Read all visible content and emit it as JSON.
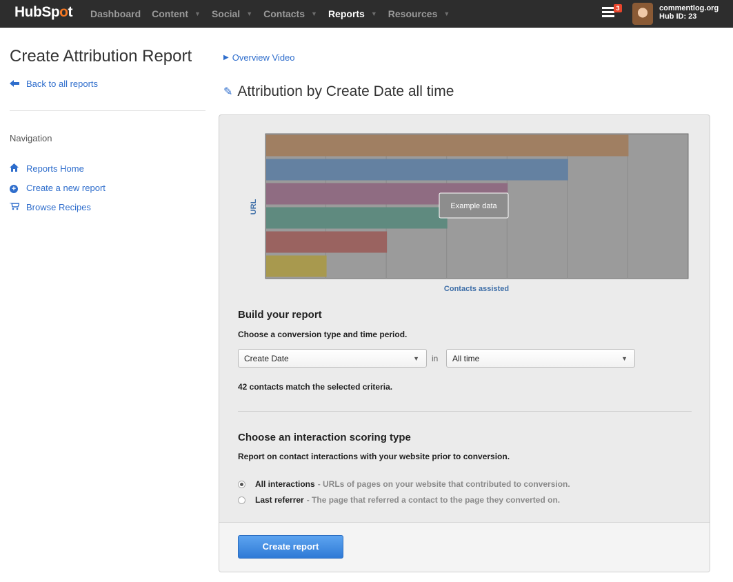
{
  "topbar": {
    "logo_prefix": "HubSp",
    "logo_o": "o",
    "logo_suffix": "t",
    "nav": [
      {
        "label": "Dashboard",
        "caret": false,
        "active": false
      },
      {
        "label": "Content",
        "caret": true,
        "active": false
      },
      {
        "label": "Social",
        "caret": true,
        "active": false
      },
      {
        "label": "Contacts",
        "caret": true,
        "active": false
      },
      {
        "label": "Reports",
        "caret": true,
        "active": true
      },
      {
        "label": "Resources",
        "caret": true,
        "active": false
      }
    ],
    "notification_count": "3",
    "account_name": "commentlog.org",
    "hub_id": "Hub ID: 23"
  },
  "sidebar": {
    "title": "Create Attribution Report",
    "back_link": "Back to all reports",
    "nav_heading": "Navigation",
    "items": [
      {
        "label": "Reports Home",
        "icon": "home-icon"
      },
      {
        "label": "Create a new report",
        "icon": "plus-circle-icon"
      },
      {
        "label": "Browse Recipes",
        "icon": "cart-icon"
      }
    ]
  },
  "main": {
    "overview_link": "Overview Video",
    "report_title": "Attribution by Create Date all time"
  },
  "chart_data": {
    "type": "bar",
    "orientation": "horizontal",
    "ylabel": "URL",
    "xlabel": "Contacts assisted",
    "overlay_label": "Example data",
    "grid": true,
    "xlim": [
      0,
      7
    ],
    "values": [
      6,
      5,
      4,
      3,
      2,
      1
    ],
    "colors": [
      "#a07f62",
      "#6481a1",
      "#8f6c82",
      "#5f8a7f",
      "#9a6360",
      "#a8994e"
    ]
  },
  "build": {
    "heading": "Build your report",
    "subheading": "Choose a conversion type and time period.",
    "conversion_type": "Create Date",
    "in_word": "in",
    "time_period": "All time",
    "match_text": "42 contacts match the selected criteria."
  },
  "scoring": {
    "heading": "Choose an interaction scoring type",
    "subheading": "Report on contact interactions with your website prior to conversion.",
    "options": [
      {
        "label": "All interactions",
        "desc": "- URLs of pages on your website that contributed to conversion.",
        "selected": true
      },
      {
        "label": "Last referrer",
        "desc": "- The page that referred a contact to the page they converted on.",
        "selected": false
      }
    ]
  },
  "footer": {
    "create_button": "Create report"
  }
}
